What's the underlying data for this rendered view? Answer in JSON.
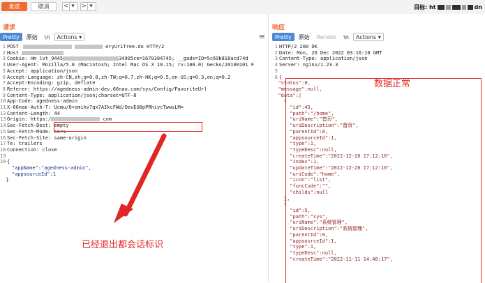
{
  "toolbar": {
    "send_label": "发送",
    "cancel_label": "取消",
    "target_label": "目标: ht",
    "target_suffix": "dn"
  },
  "request": {
    "title": "请求",
    "tabs": [
      {
        "label": "Pretty"
      },
      {
        "label": "原始"
      },
      {
        "label": "\\n"
      },
      {
        "label": "Actions ▾"
      }
    ]
  },
  "response": {
    "title": "响应",
    "tabs": [
      {
        "label": "Pretty"
      },
      {
        "label": "原始"
      },
      {
        "label": "Render"
      },
      {
        "label": "\\n"
      },
      {
        "label": "Actions ▾"
      }
    ]
  },
  "annotations": {
    "normal_data": "数据正常",
    "session_exited": "已经退出都会话标识"
  },
  "request_lines": [
    "POST",
    "eryUriTree.do HTTP/2",
    "Cookie: Hm_lvt_9445",
    "34905ce=1670384745; __gads=ID=5c69b818acd74d",
    "User-Agent: Mozilla/5.0 (Macintosh; Intel Mac OS X 10.15; rv:108.0) Gecko/20100101 F",
    "Accept: application/json",
    "Accept-Language: zh-CN,zh;q=0.8,zh-TW;q=0.7,zh-HK;q=0.5,en-US;q=0.3,en;q=0.2",
    "Accept-Encoding: gzip, deflate",
    "Referer: https://agedness-admin-dev.66nao.com/sys/Config/FavoriteUrl",
    "Content-Type: application/json;charset=UTF-8",
    "App-Code: agedness-admin",
    "X-66nao-Auth-T",
    "Ucmu/O+omikv7qx7AIkcFWd/OevEU8pPRhiycTwwsLM=",
    "Content-Length: 44",
    "Origin: https:/",
    "com",
    "Sec-Fetch-Dest: empty",
    "Sec-Fetch-Mode: cors",
    "Sec-Fetch-Site: same-origin",
    "Te: trailers",
    "Connection: close",
    "{",
    "\"appName\":\"agedness-admin\",",
    "\"appsourceId\":1",
    "}"
  ],
  "response_lines": [
    "HTTP/2 200 OK",
    "Date: Mon, 26 Dec 2022 03:16:10 GMT",
    "Content-Type: application/json",
    "Server: nginx/1.23.3",
    "{",
    "\"status\":0,",
    "\"message\":null,",
    "\"data\":[",
    "{",
    "\"id\":45,",
    "\"path\":\"/home\",",
    "\"uriName\":\"首页\",",
    "\"uriDescription\":\"首页\",",
    "\"parentId\":0,",
    "\"appsourceId\":1,",
    "\"type\":1,",
    "\"typeDesc\":null,",
    "\"createTime\":\"2022-12-20 17:12:16\",",
    "\"index\":1,",
    "\"updateTime\":\"2022-12-20 17:12:16\",",
    "\"uriCode\":\"home\",",
    "\"icon\":\"list\",",
    "\"funcCode\":\"\",",
    "\"childs\":null",
    "},",
    "{",
    "\"id\":5,",
    "\"path\":\"sys\",",
    "\"uriName\":\"系统管理\",",
    "\"uriDescription\":\"系统管理\",",
    "\"parentId\":0,",
    "\"appsourceId\":1,",
    "\"type\":1,",
    "\"typeDesc\":null,",
    "\"createTime\":\"2022-11-11 14:40:17\","
  ],
  "line_numbers": {
    "request": [
      "1",
      "2",
      "3",
      "4",
      "5",
      "6",
      "7",
      "8",
      "9",
      "10",
      "11",
      "12",
      "13",
      "14",
      "15",
      "16",
      "17",
      "18",
      "19",
      "20"
    ],
    "response": [
      "1",
      "2",
      "3",
      "4",
      "5",
      "6"
    ]
  },
  "colors": {
    "accent": "#ef6b32",
    "highlight_box": "#e12626",
    "tab_active": "#4a8ad5"
  }
}
